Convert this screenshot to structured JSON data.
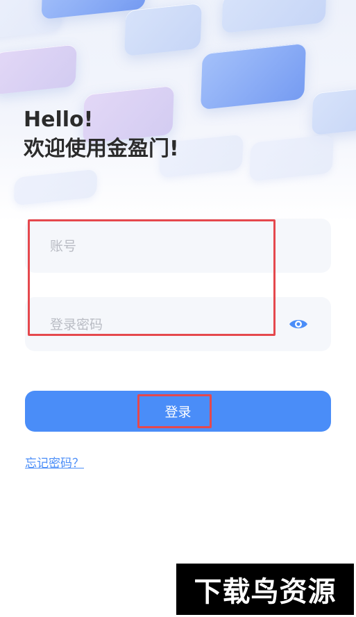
{
  "greeting": {
    "line1": "Hello!",
    "line2": "欢迎使用金盈门!"
  },
  "form": {
    "account_placeholder": "账号",
    "password_placeholder": "登录密码",
    "password_toggle_icon": "eye-icon"
  },
  "actions": {
    "login_label": "登录",
    "forgot_label": "忘记密码？"
  },
  "watermark": {
    "text": "下载鸟资源"
  },
  "colors": {
    "accent": "#4a8df8",
    "annotation": "#e5484d",
    "heading": "#2b2b2b",
    "field_bg": "#f5f7fb"
  }
}
